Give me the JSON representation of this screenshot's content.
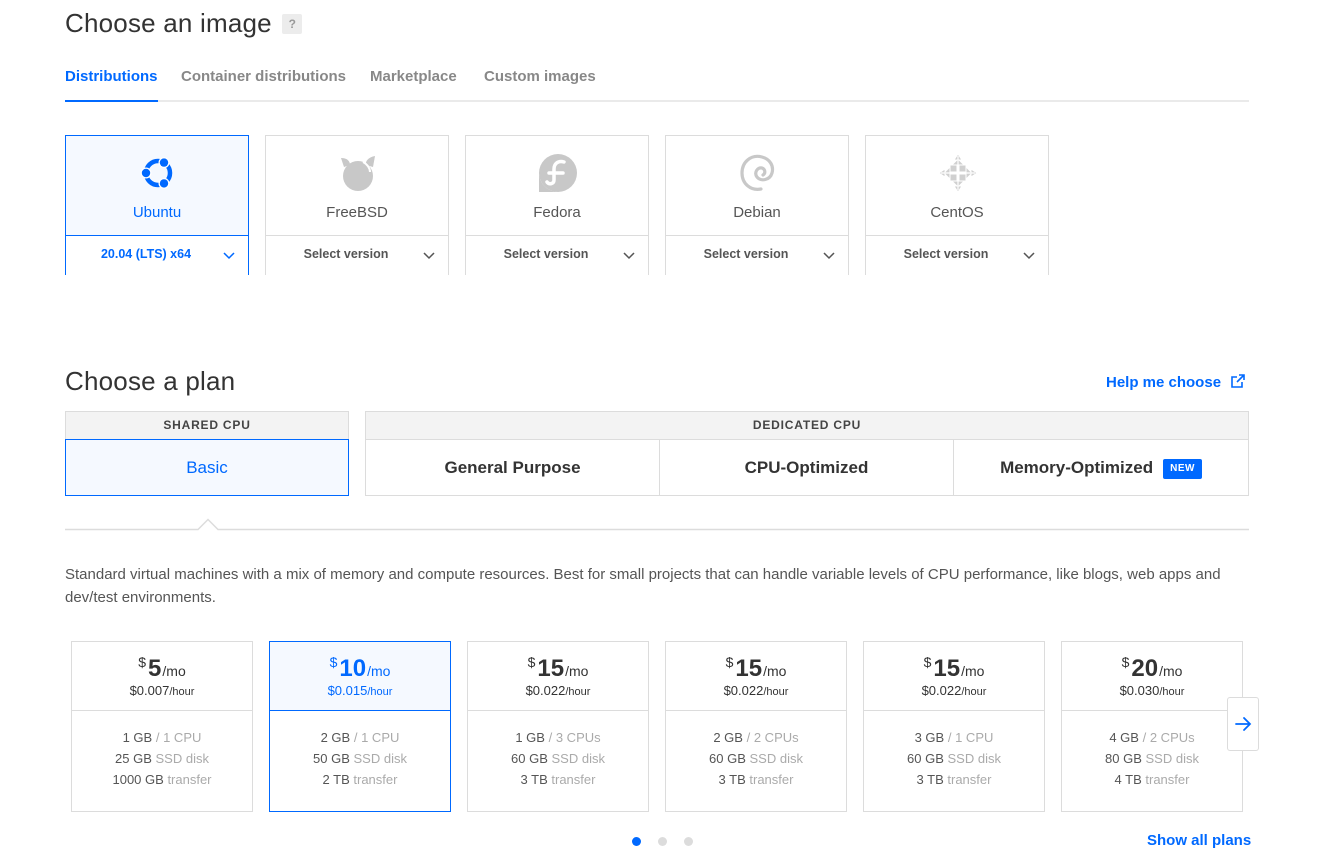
{
  "image_section": {
    "title": "Choose an image",
    "help": "?",
    "tabs": [
      "Distributions",
      "Container distributions",
      "Marketplace",
      "Custom images"
    ],
    "active_tab": "Distributions",
    "distros": [
      {
        "name": "Ubuntu",
        "version": "20.04 (LTS) x64",
        "icon": "ubuntu-icon",
        "selected": true
      },
      {
        "name": "FreeBSD",
        "version": "Select version",
        "icon": "freebsd-icon",
        "selected": false
      },
      {
        "name": "Fedora",
        "version": "Select version",
        "icon": "fedora-icon",
        "selected": false
      },
      {
        "name": "Debian",
        "version": "Select version",
        "icon": "debian-icon",
        "selected": false
      },
      {
        "name": "CentOS",
        "version": "Select version",
        "icon": "centos-icon",
        "selected": false
      }
    ]
  },
  "plan_section": {
    "title": "Choose a plan",
    "help_link": "Help me choose",
    "shared_header": "SHARED CPU",
    "dedicated_header": "DEDICATED CPU",
    "options": [
      "Basic",
      "General Purpose",
      "CPU-Optimized",
      "Memory-Optimized"
    ],
    "new_badge": "NEW",
    "selected_option": "Basic",
    "description": "Standard virtual machines with a mix of memory and compute resources. Best for small projects that can handle variable levels of CPU performance, like blogs, web apps and dev/test environments.",
    "prices": [
      {
        "currency": "$",
        "amount": "5",
        "per": "/mo",
        "hourly": "$0.007",
        "hourly_unit": "/hour",
        "mem": "1 GB",
        "cpu": "1 CPU",
        "disk": "25 GB",
        "disk_label": "SSD disk",
        "transfer": "1000 GB",
        "transfer_label": "transfer",
        "selected": false
      },
      {
        "currency": "$",
        "amount": "10",
        "per": "/mo",
        "hourly": "$0.015",
        "hourly_unit": "/hour",
        "mem": "2 GB",
        "cpu": "1 CPU",
        "disk": "50 GB",
        "disk_label": "SSD disk",
        "transfer": "2 TB",
        "transfer_label": "transfer",
        "selected": true
      },
      {
        "currency": "$",
        "amount": "15",
        "per": "/mo",
        "hourly": "$0.022",
        "hourly_unit": "/hour",
        "mem": "1 GB",
        "cpu": "3 CPUs",
        "disk": "60 GB",
        "disk_label": "SSD disk",
        "transfer": "3 TB",
        "transfer_label": "transfer",
        "selected": false
      },
      {
        "currency": "$",
        "amount": "15",
        "per": "/mo",
        "hourly": "$0.022",
        "hourly_unit": "/hour",
        "mem": "2 GB",
        "cpu": "2 CPUs",
        "disk": "60 GB",
        "disk_label": "SSD disk",
        "transfer": "3 TB",
        "transfer_label": "transfer",
        "selected": false
      },
      {
        "currency": "$",
        "amount": "15",
        "per": "/mo",
        "hourly": "$0.022",
        "hourly_unit": "/hour",
        "mem": "3 GB",
        "cpu": "1 CPU",
        "disk": "60 GB",
        "disk_label": "SSD disk",
        "transfer": "3 TB",
        "transfer_label": "transfer",
        "selected": false
      },
      {
        "currency": "$",
        "amount": "20",
        "per": "/mo",
        "hourly": "$0.030",
        "hourly_unit": "/hour",
        "mem": "4 GB",
        "cpu": "2 CPUs",
        "disk": "80 GB",
        "disk_label": "SSD disk",
        "transfer": "4 TB",
        "transfer_label": "transfer",
        "selected": false
      }
    ],
    "pagination": {
      "pages": 3,
      "current": 1
    },
    "show_all": "Show all plans"
  },
  "colors": {
    "accent": "#0069ff",
    "border": "#dcdcdc",
    "muted": "#aaaaaa"
  }
}
